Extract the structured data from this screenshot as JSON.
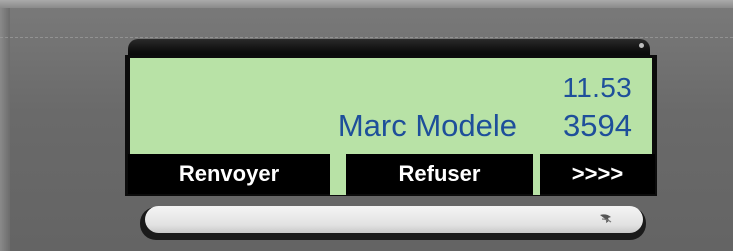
{
  "display": {
    "time": "11.53",
    "caller_name": "Marc Modele",
    "caller_number": "3594"
  },
  "softkeys": [
    {
      "label": "Renvoyer"
    },
    {
      "label": "Refuser"
    },
    {
      "label": ">>>>"
    }
  ],
  "colors": {
    "lcd_background": "#b8e2a6",
    "lcd_text": "#1e4f9a",
    "softkey_background": "#000000",
    "softkey_text": "#ffffff",
    "device_body": "#6c6c6c"
  },
  "icons": {
    "navigation": "arrow-down-icon"
  }
}
